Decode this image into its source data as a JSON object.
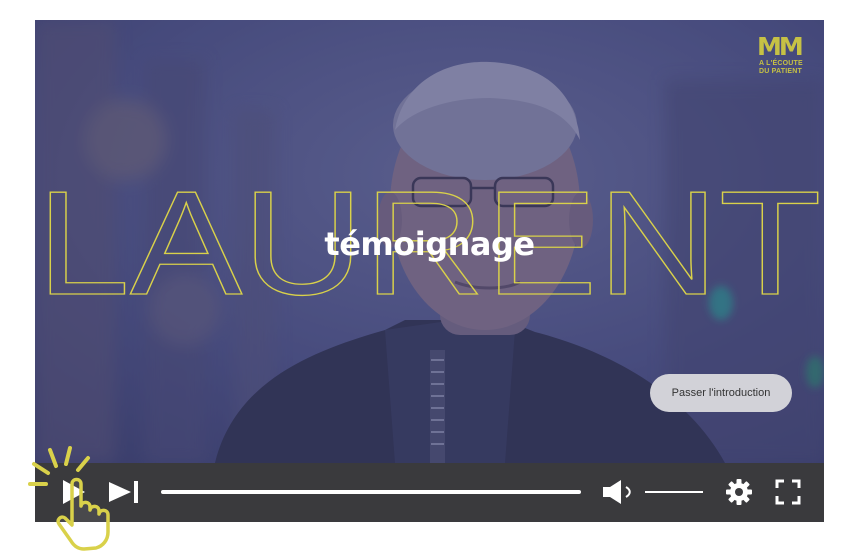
{
  "video": {
    "title_outline": "LAURENT",
    "subtitle": "témoignage",
    "skip_intro_label": "Passer l'introduction"
  },
  "logo": {
    "mark": "MM",
    "line1": "A L'ÉCOUTE",
    "line2": "DU PATIENT"
  },
  "player": {
    "progress": 0.0,
    "volume": 1.0,
    "state": "paused"
  },
  "icons": {
    "play": "play-icon",
    "next": "skip-next-icon",
    "volume": "volume-icon",
    "settings": "gear-icon",
    "fullscreen": "fullscreen-icon",
    "cursor": "hand-pointer-icon"
  },
  "colors": {
    "accent": "#d9d14a",
    "control_bar": "#3a3a3d",
    "overlay": "#4a4f7a",
    "button_bg": "#d2d2d8"
  }
}
